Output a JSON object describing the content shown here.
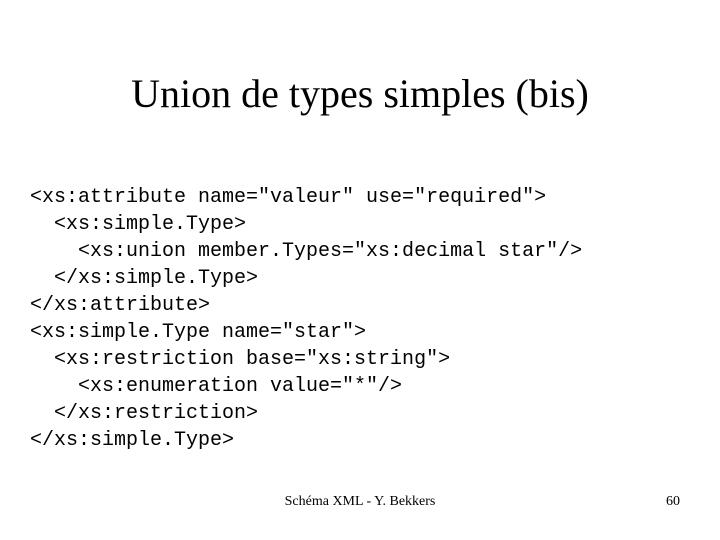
{
  "title": "Union de types simples (bis)",
  "code_lines": [
    "<xs:attribute name=\"valeur\" use=\"required\">",
    "  <xs:simple.Type>",
    "    <xs:union member.Types=\"xs:decimal star\"/>",
    "  </xs:simple.Type>",
    "</xs:attribute>",
    "<xs:simple.Type name=\"star\">",
    "  <xs:restriction base=\"xs:string\">",
    "    <xs:enumeration value=\"*\"/>",
    "  </xs:restriction>",
    "</xs:simple.Type>"
  ],
  "footer_center": "Schéma XML - Y. Bekkers",
  "page_number": "60"
}
